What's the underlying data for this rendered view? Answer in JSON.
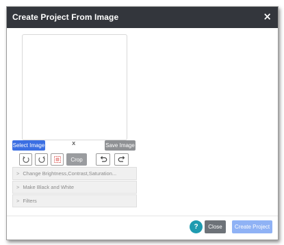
{
  "window": {
    "title": "Create Project From Image",
    "close_glyph": "×",
    "close_icon": "close-icon"
  },
  "image_panel": {
    "select_label": "Select Image",
    "clear_glyph": "x",
    "save_label": "Save Image"
  },
  "toolbar": {
    "rotate_left_icon": "rotate-left-icon",
    "rotate_right_icon": "rotate-right-icon",
    "crop_select_icon": "crop-select-icon",
    "crop_label": "Crop",
    "undo_icon": "undo-icon",
    "redo_icon": "redo-icon"
  },
  "adjustments": [
    {
      "chevron": ">",
      "label": "Change Brightness,Contrast,Saturation..."
    },
    {
      "chevron": ">",
      "label": "Make Black and White"
    },
    {
      "chevron": ">",
      "label": "Filters"
    }
  ],
  "footer": {
    "help_label": "?",
    "close_label": "Close",
    "create_label": "Create Project"
  },
  "colors": {
    "titlebar": "#33363c",
    "primary": "#3b6fe3",
    "create_disabled": "#8fb2f5",
    "help": "#1e9bb0",
    "secondary": "#6d7278",
    "crop_select_icon": "#d9534f"
  }
}
